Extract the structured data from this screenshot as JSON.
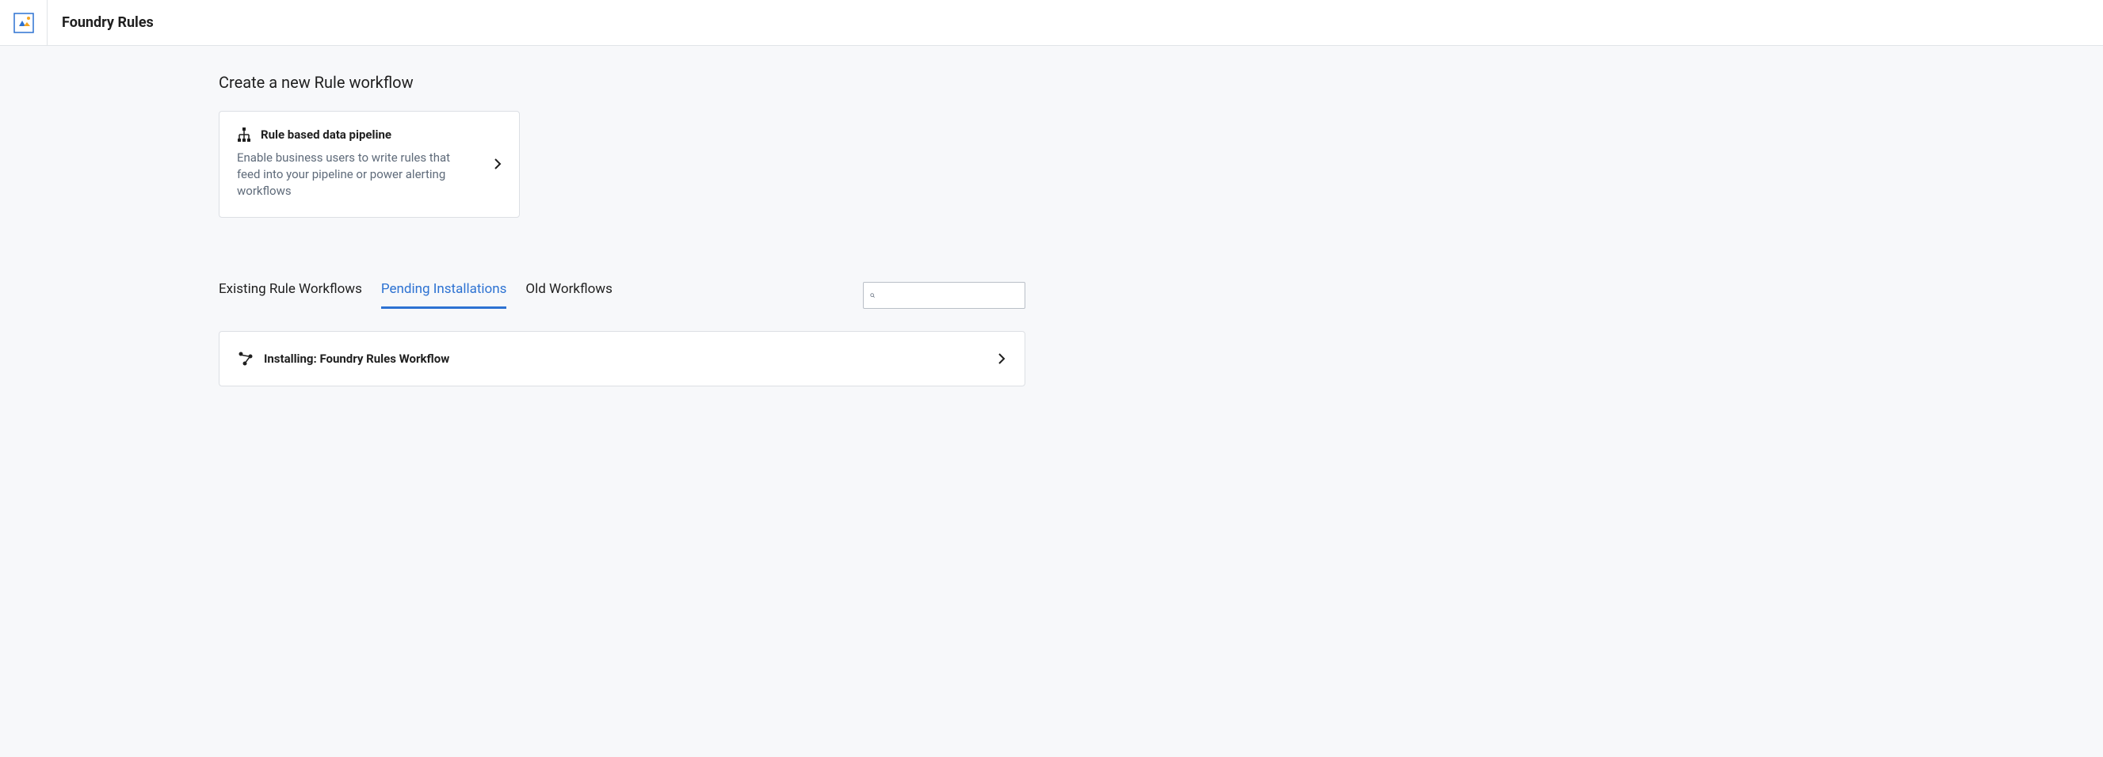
{
  "header": {
    "title": "Foundry Rules"
  },
  "create_section": {
    "heading": "Create a new Rule workflow",
    "card": {
      "title": "Rule based data pipeline",
      "description": "Enable business users to write rules that feed into your pipeline or power alerting workflows"
    }
  },
  "tabs": {
    "existing": "Existing Rule Workflows",
    "pending": "Pending Installations",
    "old": "Old Workflows"
  },
  "search": {
    "placeholder": ""
  },
  "installing": {
    "label": "Installing: Foundry Rules Workflow"
  }
}
